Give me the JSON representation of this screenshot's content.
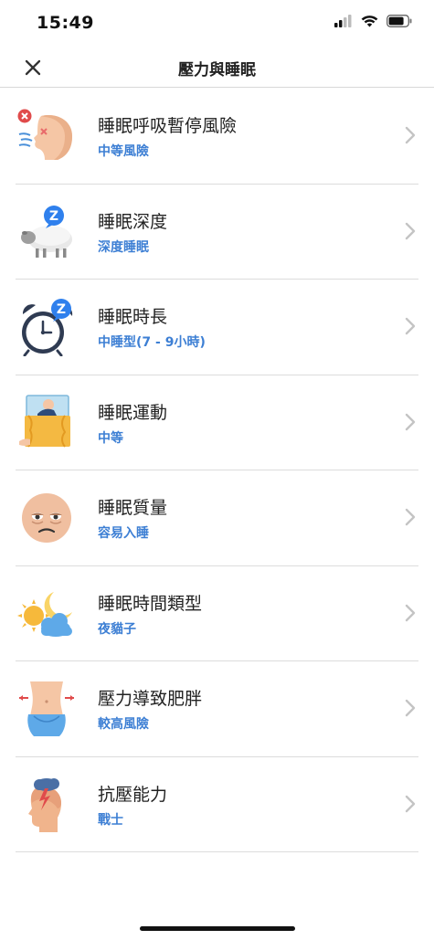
{
  "status_bar": {
    "time": "15:49"
  },
  "nav": {
    "title": "壓力與睡眠"
  },
  "items": [
    {
      "title": "睡眠呼吸暫停風險",
      "subtitle": "中等風險",
      "icon": "sleep-apnea-face-icon"
    },
    {
      "title": "睡眠深度",
      "subtitle": "深度睡眠",
      "icon": "sleeping-sheep-icon"
    },
    {
      "title": "睡眠時長",
      "subtitle": "中睡型(7 - 9小時)",
      "icon": "alarm-clock-icon"
    },
    {
      "title": "睡眠運動",
      "subtitle": "中等",
      "icon": "person-in-bed-icon"
    },
    {
      "title": "睡眠質量",
      "subtitle": "容易入睡",
      "icon": "tired-face-icon"
    },
    {
      "title": "睡眠時間類型",
      "subtitle": "夜貓子",
      "icon": "sun-moon-cloud-icon"
    },
    {
      "title": "壓力導致肥胖",
      "subtitle": "較高風險",
      "icon": "waist-measure-icon"
    },
    {
      "title": "抗壓能力",
      "subtitle": "戰士",
      "icon": "stress-head-icon"
    }
  ],
  "colors": {
    "accent": "#3d7fd4",
    "divider": "#dcdcdc",
    "chevron": "#c4c4c4"
  }
}
